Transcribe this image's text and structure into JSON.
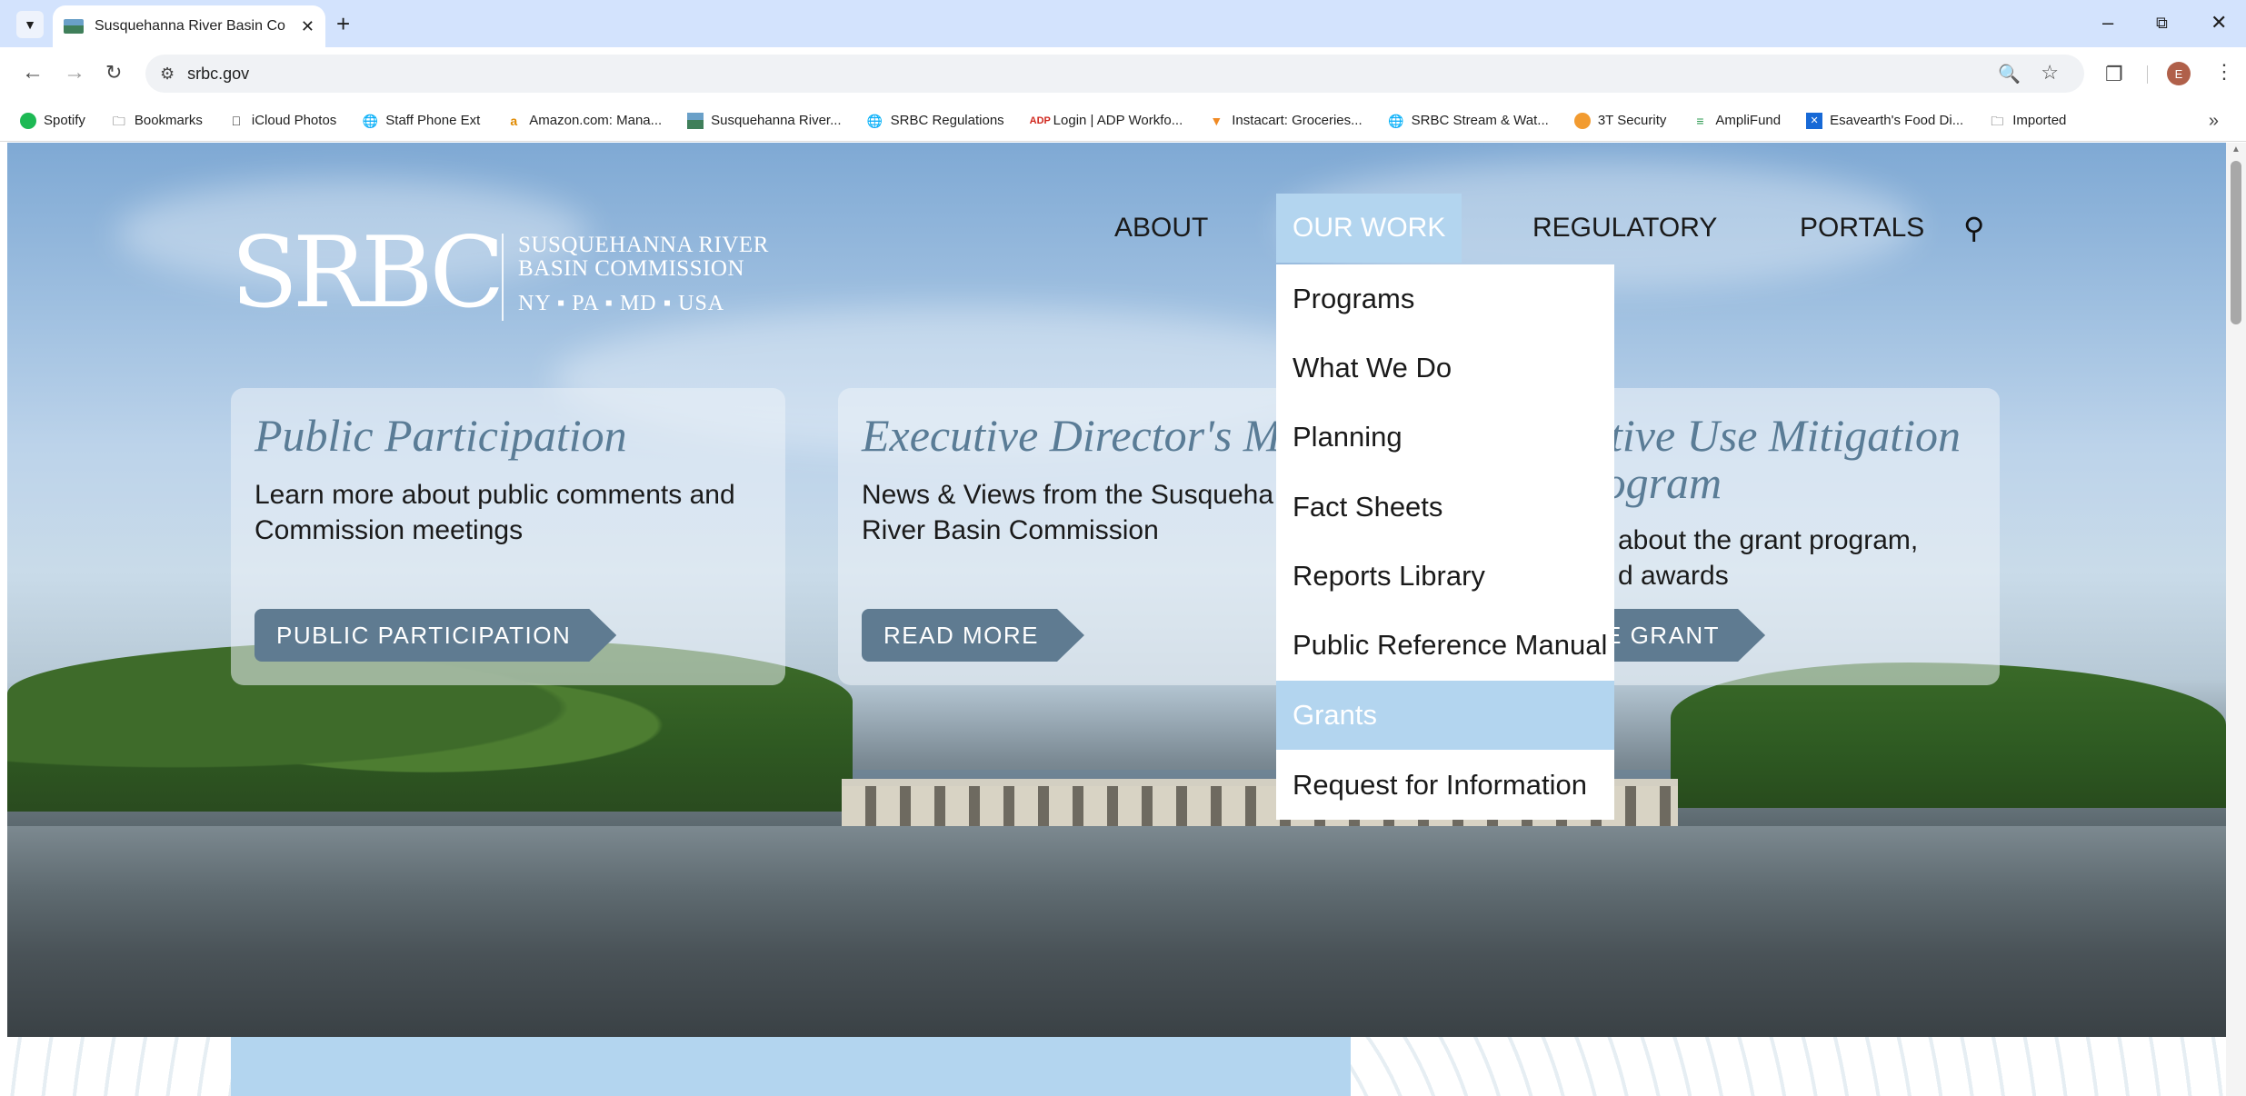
{
  "browser": {
    "tab_title": "Susquehanna River Basin Comm",
    "url": "srbc.gov",
    "profile_initial": "E",
    "bookmarks": [
      {
        "label": "Spotify",
        "icon": "spotify-icon"
      },
      {
        "label": "Bookmarks",
        "icon": "folder-icon"
      },
      {
        "label": "iCloud Photos",
        "icon": "apple-icon"
      },
      {
        "label": "Staff Phone Ext",
        "icon": "globe-icon"
      },
      {
        "label": "Amazon.com: Mana...",
        "icon": "amazon-icon"
      },
      {
        "label": "Susquehanna River...",
        "icon": "srbc-favicon"
      },
      {
        "label": "SRBC Regulations",
        "icon": "globe-icon"
      },
      {
        "label": "Login | ADP Workfo...",
        "icon": "adp-icon"
      },
      {
        "label": "Instacart: Groceries...",
        "icon": "carrot-icon"
      },
      {
        "label": "SRBC Stream & Wat...",
        "icon": "globe-icon"
      },
      {
        "label": "3T Security",
        "icon": "shield-icon"
      },
      {
        "label": "AmpliFund",
        "icon": "amplifund-icon"
      },
      {
        "label": "Esavearth's Food Di...",
        "icon": "bookmark-app-icon"
      },
      {
        "label": "Imported",
        "icon": "folder-icon"
      }
    ]
  },
  "site": {
    "logo": {
      "mark": "SRBC",
      "name_line1": "SUSQUEHANNA RIVER",
      "name_line2": "BASIN COMMISSION",
      "states": "NY ▪ PA ▪ MD ▪ USA"
    },
    "nav": {
      "about": "ABOUT",
      "our_work": "OUR WORK",
      "regulatory": "REGULATORY",
      "portals": "PORTALS"
    },
    "dropdown": [
      "Programs",
      "What We Do",
      "Planning",
      "Fact Sheets",
      "Reports Library",
      "Public Reference Manual",
      "Grants",
      "Request for Information"
    ],
    "cards": [
      {
        "title": "Public Participation",
        "text_line1": "Learn more about public comments and",
        "text_line2": "Commission meetings",
        "button": "PUBLIC PARTICIPATION"
      },
      {
        "title": "Executive Director's Mes",
        "text_line1": "News & Views from the Susqueha",
        "text_line2": "River Basin Commission",
        "button": "READ MORE"
      },
      {
        "title_line1": "ptive Use Mitigation",
        "title_line2": "rogram",
        "text_line1": "about the grant program,",
        "text_line2": "d awards",
        "button": "E GRANT"
      }
    ]
  },
  "colors": {
    "accent_light_blue": "#b3d5ef",
    "button_slate": "#5f7b91",
    "card_title": "#5a7c96"
  }
}
